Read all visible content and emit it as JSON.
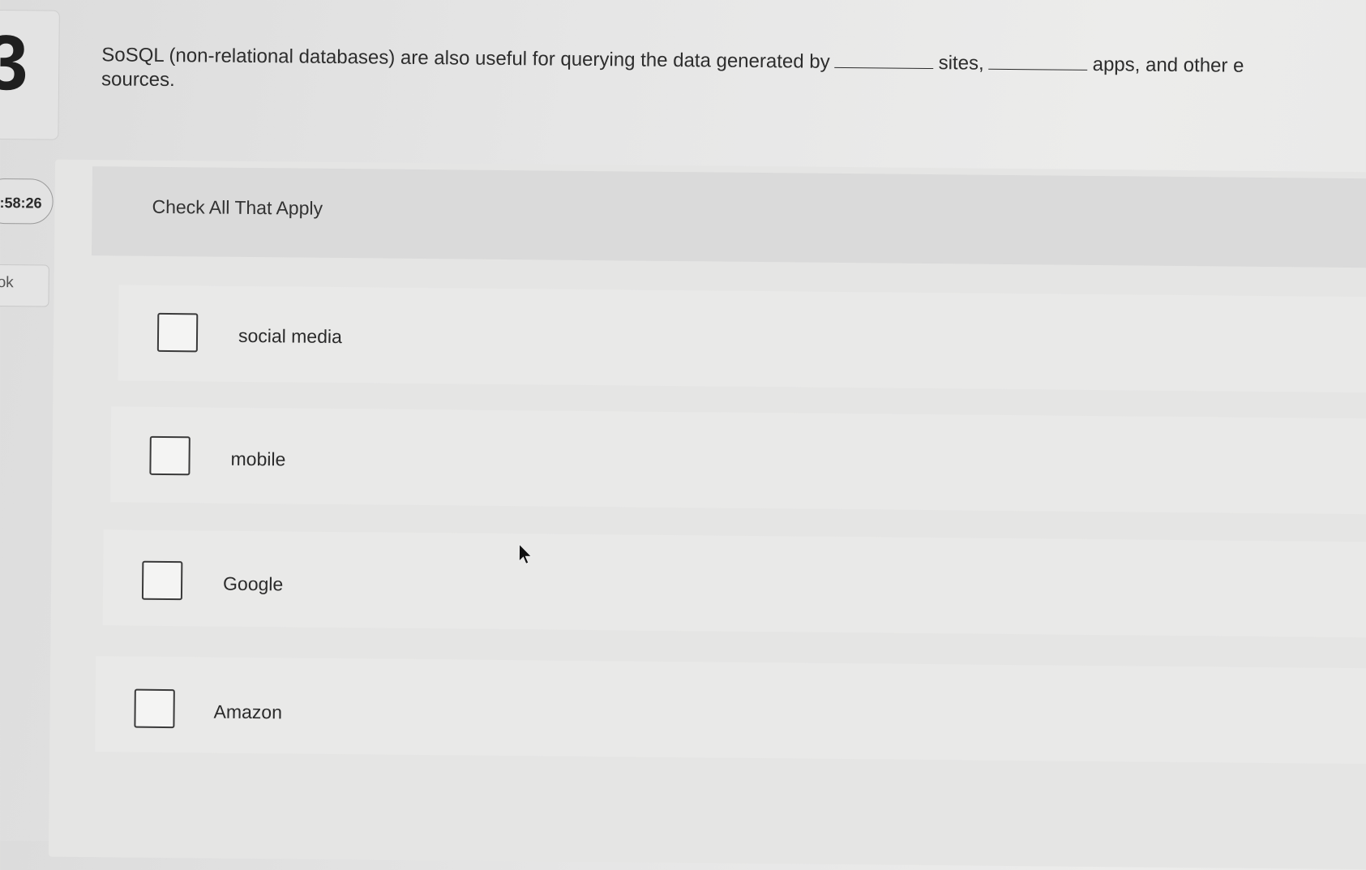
{
  "question": {
    "number": "3",
    "text_part1": "SoSQL (non-relational databases) are also useful for querying the data generated by",
    "text_part2": "sites,",
    "text_part3": "apps, and other e",
    "text_part4": "sources."
  },
  "sidebar": {
    "timer": ":58:26",
    "book_label": "ok"
  },
  "instruction": "Check All That Apply",
  "options": [
    {
      "label": "social media",
      "checked": false
    },
    {
      "label": "mobile",
      "checked": false
    },
    {
      "label": "Google",
      "checked": false
    },
    {
      "label": "Amazon",
      "checked": false
    }
  ]
}
